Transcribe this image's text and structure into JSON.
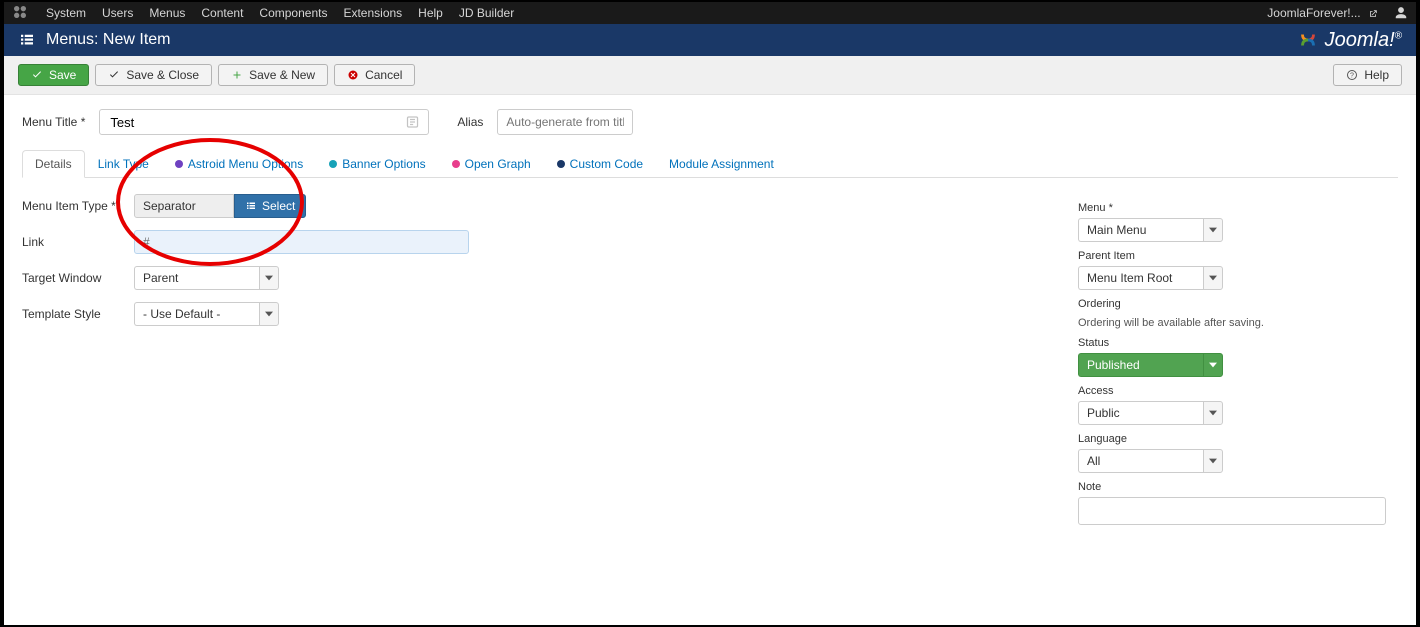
{
  "topbar": {
    "items": [
      "System",
      "Users",
      "Menus",
      "Content",
      "Components",
      "Extensions",
      "Help",
      "JD Builder"
    ],
    "user_label": "JoomlaForever!..."
  },
  "header": {
    "title": "Menus: New Item",
    "brand": "Joomla!"
  },
  "toolbar": {
    "save": "Save",
    "save_close": "Save & Close",
    "save_new": "Save & New",
    "cancel": "Cancel",
    "help": "Help"
  },
  "title_row": {
    "menu_title_label": "Menu Title *",
    "menu_title_value": "Test",
    "alias_label": "Alias",
    "alias_placeholder": "Auto-generate from title"
  },
  "tabs": [
    {
      "label": "Details",
      "active": true,
      "dot": ""
    },
    {
      "label": "Link Type",
      "active": false,
      "dot": ""
    },
    {
      "label": "Astroid Menu Options",
      "active": false,
      "dot": "#6f42c1"
    },
    {
      "label": "Banner Options",
      "active": false,
      "dot": "#17a2b8"
    },
    {
      "label": "Open Graph",
      "active": false,
      "dot": "#e83e8c"
    },
    {
      "label": "Custom Code",
      "active": false,
      "dot": "#1a3867"
    },
    {
      "label": "Module Assignment",
      "active": false,
      "dot": ""
    }
  ],
  "left_form": {
    "menu_item_type_label": "Menu Item Type *",
    "menu_item_type_value": "Separator",
    "select_label": "Select",
    "link_label": "Link",
    "link_value": "#",
    "target_window_label": "Target Window",
    "target_window_value": "Parent",
    "template_style_label": "Template Style",
    "template_style_value": "- Use Default -"
  },
  "right_form": {
    "menu_label": "Menu *",
    "menu_value": "Main Menu",
    "parent_label": "Parent Item",
    "parent_value": "Menu Item Root",
    "ordering_label": "Ordering",
    "ordering_text": "Ordering will be available after saving.",
    "status_label": "Status",
    "status_value": "Published",
    "access_label": "Access",
    "access_value": "Public",
    "language_label": "Language",
    "language_value": "All",
    "note_label": "Note"
  }
}
